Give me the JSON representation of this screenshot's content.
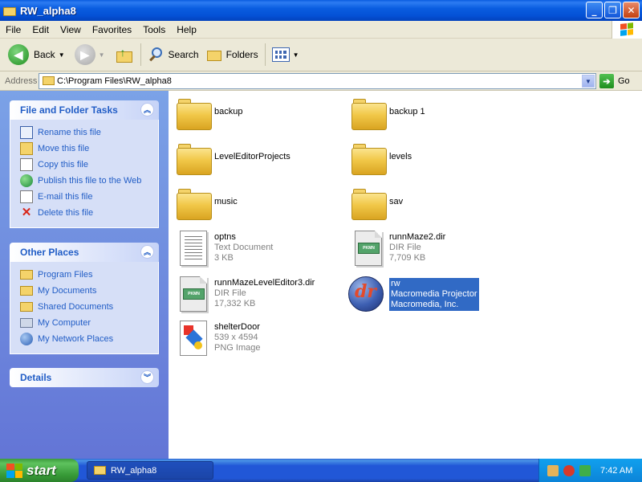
{
  "window": {
    "title": "RW_alpha8"
  },
  "menu": [
    "File",
    "Edit",
    "View",
    "Favorites",
    "Tools",
    "Help"
  ],
  "toolbar": {
    "back": "Back",
    "search": "Search",
    "folders": "Folders"
  },
  "address": {
    "label": "Address",
    "path": "C:\\Program Files\\RW_alpha8",
    "go": "Go"
  },
  "tasks": {
    "title": "File and Folder Tasks",
    "items": [
      "Rename this file",
      "Move this file",
      "Copy this file",
      "Publish this file to the Web",
      "E-mail this file",
      "Delete this file"
    ]
  },
  "places": {
    "title": "Other Places",
    "items": [
      "Program Files",
      "My Documents",
      "Shared Documents",
      "My Computer",
      "My Network Places"
    ]
  },
  "details": {
    "title": "Details"
  },
  "files": [
    {
      "name": "backup"
    },
    {
      "name": "backup 1"
    },
    {
      "name": "LevelEditorProjects"
    },
    {
      "name": "levels"
    },
    {
      "name": "music"
    },
    {
      "name": "sav"
    },
    {
      "name": "optns",
      "type": "Text Document",
      "size": "3 KB"
    },
    {
      "name": "runnMaze2.dir",
      "type": "DIR File",
      "size": "7,709 KB"
    },
    {
      "name": "runnMazeLevelEditor3.dir",
      "type": "DIR File",
      "size": "17,332 KB"
    },
    {
      "name": "rw",
      "type": "Macromedia Projector",
      "size": "Macromedia, Inc."
    },
    {
      "name": "shelterDoor",
      "type": "539 x 4594",
      "size": "PNG Image"
    }
  ],
  "taskbar": {
    "start": "start",
    "app": "RW_alpha8",
    "time": "7:42 AM"
  },
  "colors": {
    "titlebar": "#0a5de0",
    "taskpane_link": "#215dc6",
    "selection": "#316ac5"
  }
}
